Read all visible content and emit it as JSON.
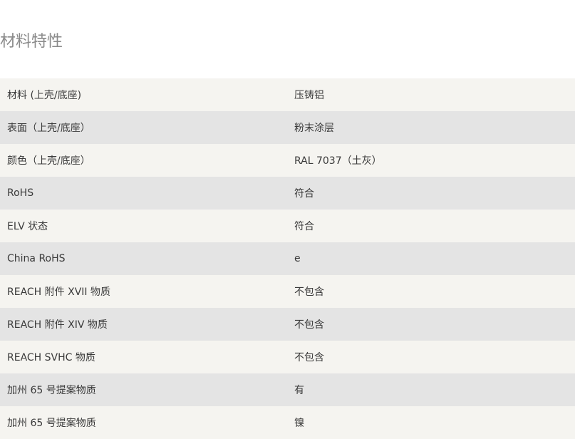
{
  "section": {
    "title": "材料特性"
  },
  "rows": [
    {
      "key": "材料 (上壳/底座)",
      "value": "压铸铝"
    },
    {
      "key": "表面（上壳/底座）",
      "value": "粉末涂层"
    },
    {
      "key": "颜色（上壳/底座）",
      "value": "RAL 7037（土灰）"
    },
    {
      "key": "RoHS",
      "value": "符合"
    },
    {
      "key": "ELV 状态",
      "value": "符合"
    },
    {
      "key": "China RoHS",
      "value": "e"
    },
    {
      "key": "REACH 附件 XVII 物质",
      "value": "不包含"
    },
    {
      "key": "REACH 附件 XIV 物质",
      "value": "不包含"
    },
    {
      "key": "REACH SVHC 物质",
      "value": "不包含"
    },
    {
      "key": "加州 65 号提案物质",
      "value": "有"
    },
    {
      "key": "加州 65 号提案物质",
      "value": "镍"
    }
  ]
}
